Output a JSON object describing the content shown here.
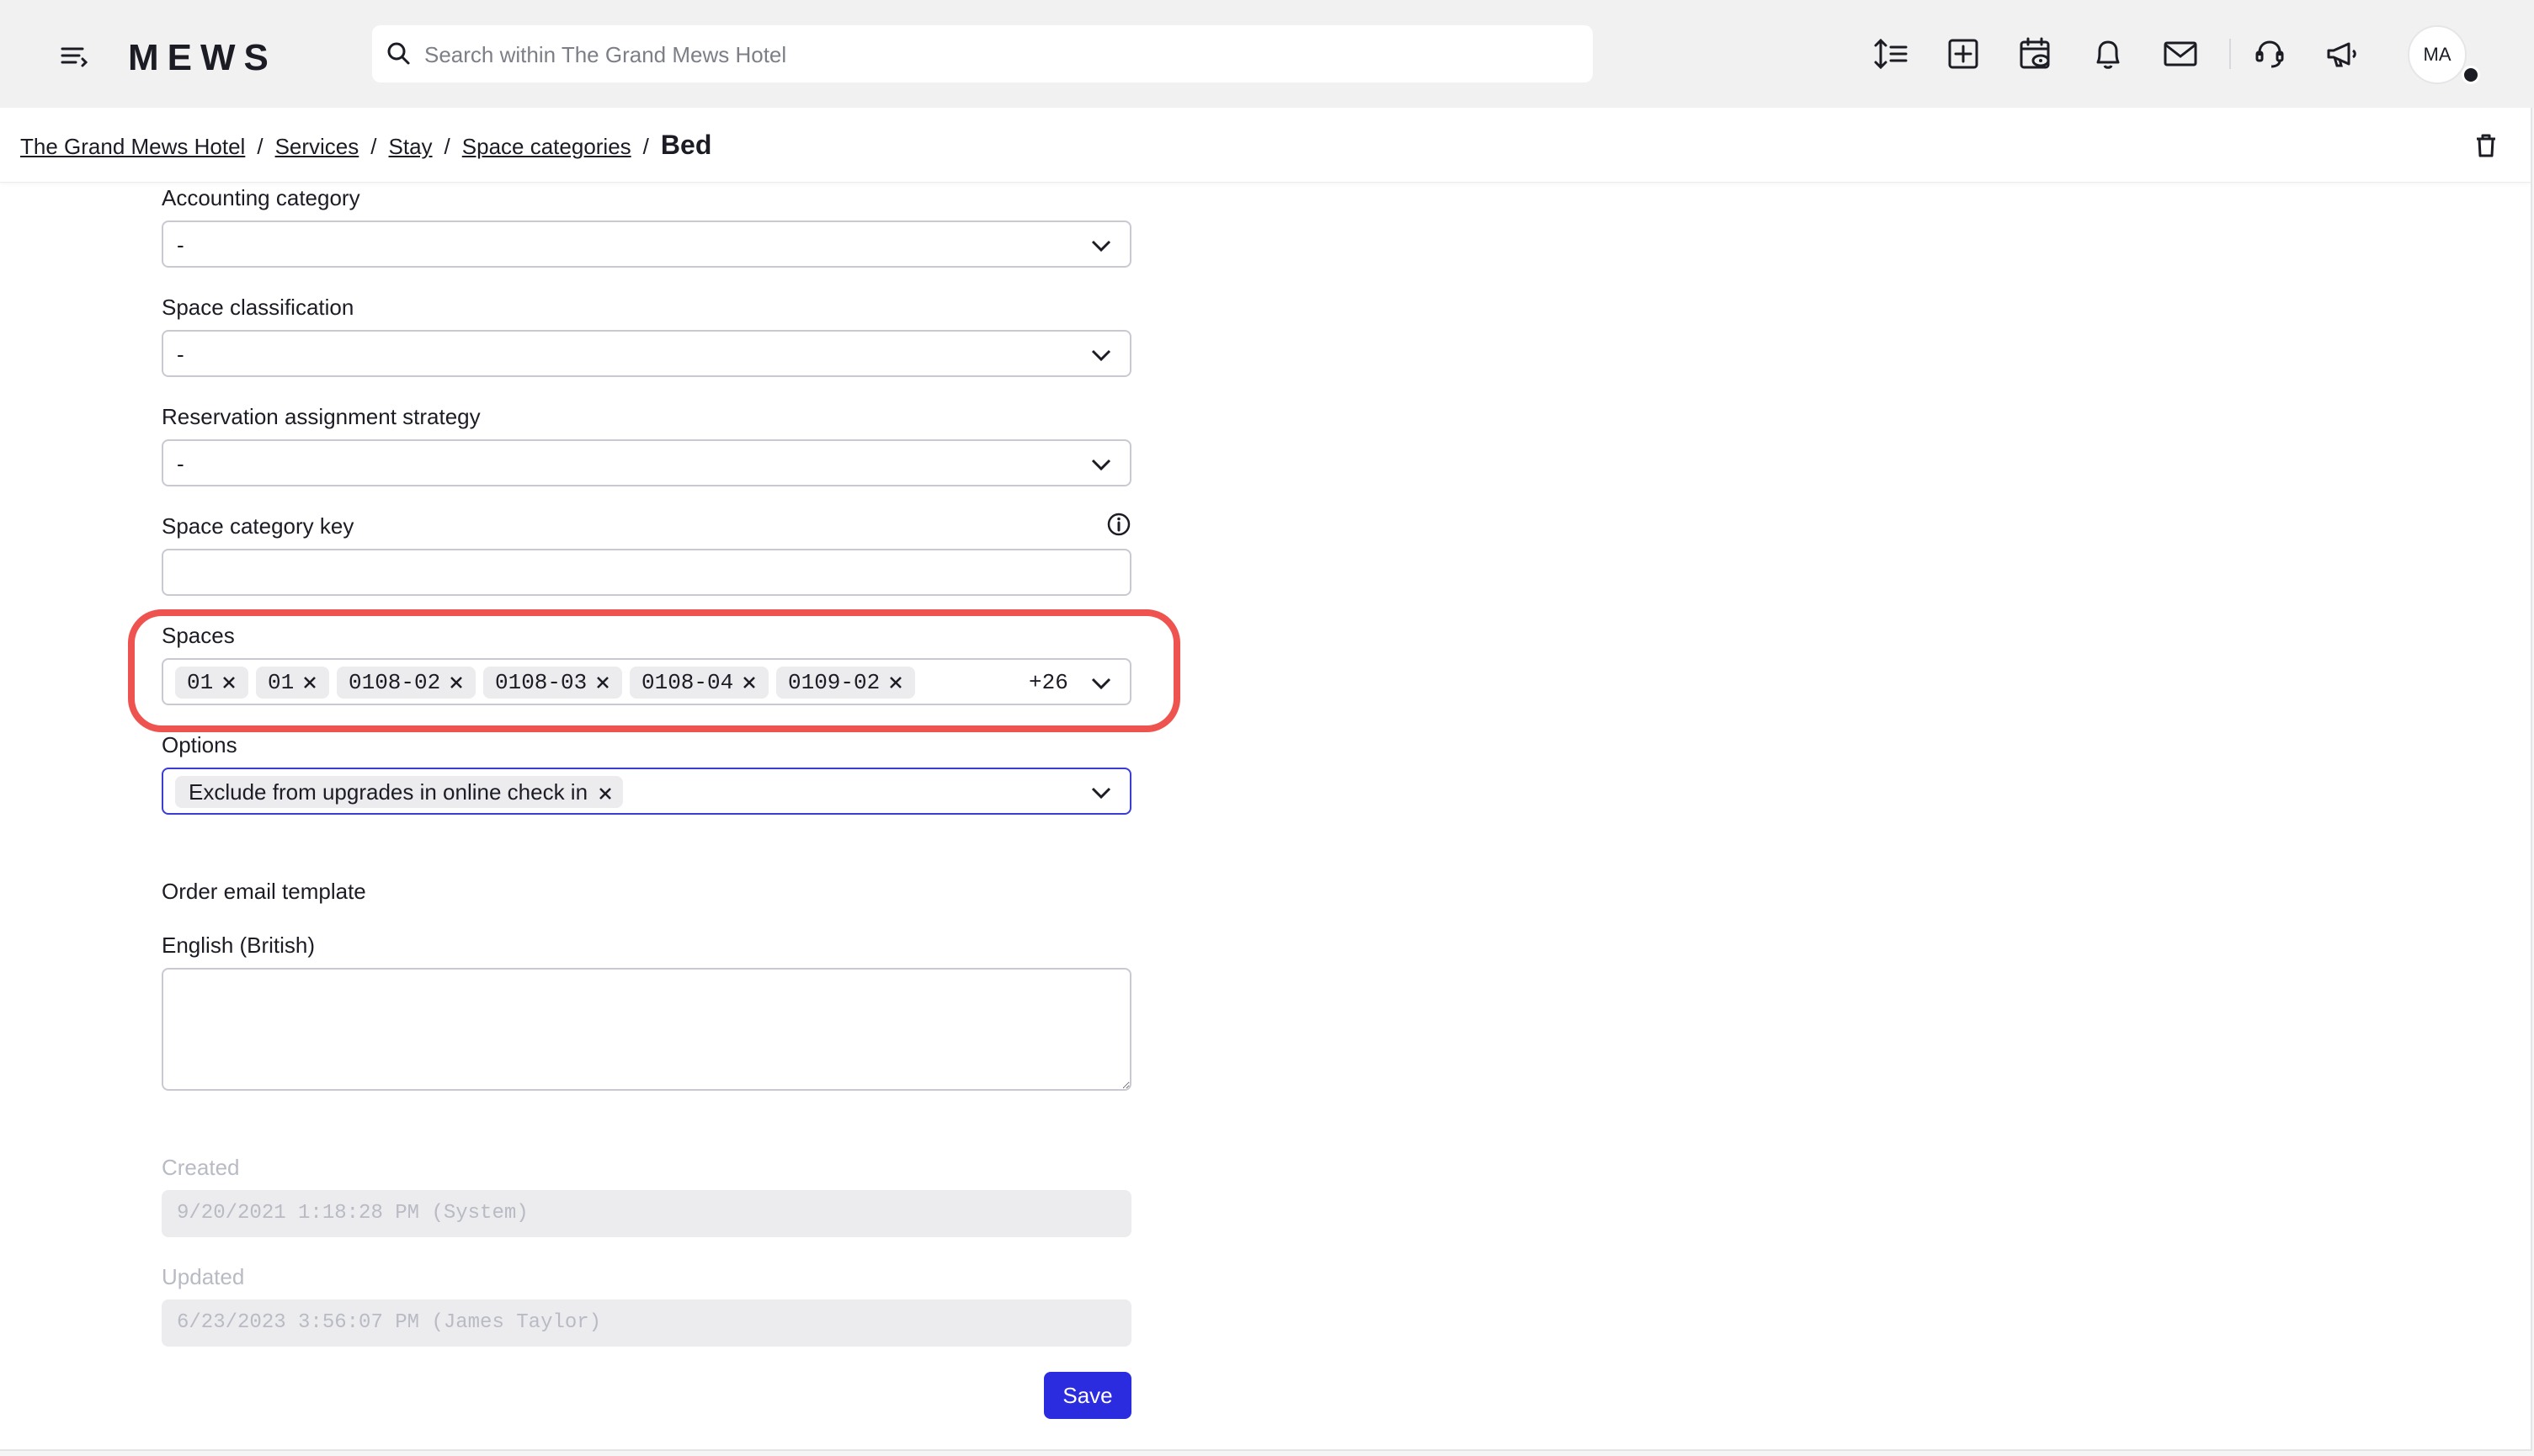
{
  "header": {
    "logo": "MEWS",
    "search_placeholder": "Search within The Grand Mews Hotel",
    "avatar_initials": "MA"
  },
  "breadcrumb": {
    "items": [
      "The Grand Mews Hotel",
      "Services",
      "Stay",
      "Space categories"
    ],
    "separator": "/",
    "current": "Bed"
  },
  "form": {
    "accounting_category": {
      "label": "Accounting category",
      "value": "-"
    },
    "space_classification": {
      "label": "Space classification",
      "value": "-"
    },
    "reservation_assignment": {
      "label": "Reservation assignment strategy",
      "value": "-"
    },
    "space_category_key": {
      "label": "Space category key",
      "value": ""
    },
    "spaces": {
      "label": "Spaces",
      "chips": [
        "01",
        "01",
        "0108-02",
        "0108-03",
        "0108-04",
        "0109-02"
      ],
      "more": "+26"
    },
    "options": {
      "label": "Options",
      "chips": [
        "Exclude from upgrades in online check in"
      ]
    },
    "order_email_template": {
      "heading": "Order email template",
      "language_label": "English (British)",
      "value": ""
    },
    "created": {
      "label": "Created",
      "value": "9/20/2021 1:18:28 PM (System)"
    },
    "updated": {
      "label": "Updated",
      "value": "6/23/2023 3:56:07 PM (James Taylor)"
    },
    "save_label": "Save"
  },
  "colors": {
    "accent": "#2b2be0",
    "highlight": "#ef5350"
  }
}
